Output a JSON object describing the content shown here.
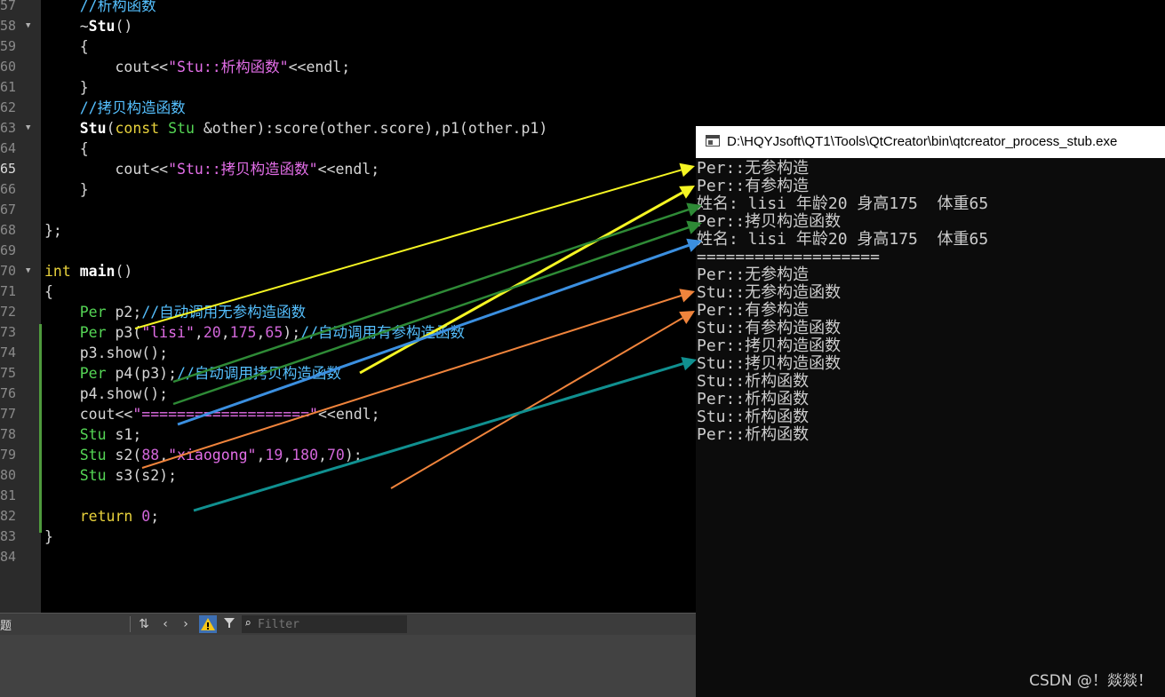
{
  "editor": {
    "gutter": [
      {
        "num": "57",
        "fold": ""
      },
      {
        "num": "58",
        "fold": "▼"
      },
      {
        "num": "59",
        "fold": ""
      },
      {
        "num": "60",
        "fold": ""
      },
      {
        "num": "61",
        "fold": ""
      },
      {
        "num": "62",
        "fold": ""
      },
      {
        "num": "63",
        "fold": "▼"
      },
      {
        "num": "64",
        "fold": ""
      },
      {
        "num": "65",
        "fold": ""
      },
      {
        "num": "66",
        "fold": ""
      },
      {
        "num": "67",
        "fold": ""
      },
      {
        "num": "68",
        "fold": ""
      },
      {
        "num": "69",
        "fold": ""
      },
      {
        "num": "70",
        "fold": "▼"
      },
      {
        "num": "71",
        "fold": ""
      },
      {
        "num": "72",
        "fold": ""
      },
      {
        "num": "73",
        "fold": ""
      },
      {
        "num": "74",
        "fold": ""
      },
      {
        "num": "75",
        "fold": ""
      },
      {
        "num": "76",
        "fold": ""
      },
      {
        "num": "77",
        "fold": ""
      },
      {
        "num": "78",
        "fold": ""
      },
      {
        "num": "79",
        "fold": ""
      },
      {
        "num": "80",
        "fold": ""
      },
      {
        "num": "81",
        "fold": ""
      },
      {
        "num": "82",
        "fold": ""
      },
      {
        "num": "83",
        "fold": ""
      },
      {
        "num": "84",
        "fold": ""
      }
    ],
    "current_line": "65",
    "code_lines": [
      [
        {
          "t": "    ",
          "c": "pl"
        },
        {
          "t": "//析构函数",
          "c": "cm"
        }
      ],
      [
        {
          "t": "    ~",
          "c": "pl"
        },
        {
          "t": "Stu",
          "c": "fn"
        },
        {
          "t": "()",
          "c": "pl"
        }
      ],
      [
        {
          "t": "    {",
          "c": "pl"
        }
      ],
      [
        {
          "t": "        cout<<",
          "c": "pl"
        },
        {
          "t": "\"Stu::析构函数\"",
          "c": "st"
        },
        {
          "t": "<<endl;",
          "c": "pl"
        }
      ],
      [
        {
          "t": "    }",
          "c": "pl"
        }
      ],
      [
        {
          "t": "    ",
          "c": "pl"
        },
        {
          "t": "//拷贝构造函数",
          "c": "cm"
        }
      ],
      [
        {
          "t": "    ",
          "c": "pl"
        },
        {
          "t": "Stu",
          "c": "fn"
        },
        {
          "t": "(",
          "c": "pl"
        },
        {
          "t": "const",
          "c": "kw"
        },
        {
          "t": " ",
          "c": "pl"
        },
        {
          "t": "Stu",
          "c": "ty"
        },
        {
          "t": " &other):score(other.score),p1(other.p1)",
          "c": "pl"
        }
      ],
      [
        {
          "t": "    {",
          "c": "pl"
        }
      ],
      [
        {
          "t": "        cout<<",
          "c": "pl"
        },
        {
          "t": "\"Stu::拷贝构造函数\"",
          "c": "st"
        },
        {
          "t": "<<endl;",
          "c": "pl"
        }
      ],
      [
        {
          "t": "    }",
          "c": "pl"
        }
      ],
      [],
      [
        {
          "t": "};",
          "c": "pl"
        }
      ],
      [],
      [
        {
          "t": "int",
          "c": "kw"
        },
        {
          "t": " ",
          "c": "pl"
        },
        {
          "t": "main",
          "c": "fn"
        },
        {
          "t": "()",
          "c": "pl"
        }
      ],
      [
        {
          "t": "{",
          "c": "pl"
        }
      ],
      [
        {
          "t": "    ",
          "c": "pl"
        },
        {
          "t": "Per",
          "c": "ty"
        },
        {
          "t": " p2;",
          "c": "pl"
        },
        {
          "t": "//自动调用无参构造函数",
          "c": "cm"
        }
      ],
      [
        {
          "t": "    ",
          "c": "pl"
        },
        {
          "t": "Per",
          "c": "ty"
        },
        {
          "t": " p3(",
          "c": "pl"
        },
        {
          "t": "\"lisi\"",
          "c": "st"
        },
        {
          "t": ",",
          "c": "pl"
        },
        {
          "t": "20",
          "c": "nm"
        },
        {
          "t": ",",
          "c": "pl"
        },
        {
          "t": "175",
          "c": "nm"
        },
        {
          "t": ",",
          "c": "pl"
        },
        {
          "t": "65",
          "c": "nm"
        },
        {
          "t": ");",
          "c": "pl"
        },
        {
          "t": "//自动调用有参构造函数",
          "c": "cm"
        }
      ],
      [
        {
          "t": "    p3.show();",
          "c": "pl"
        }
      ],
      [
        {
          "t": "    ",
          "c": "pl"
        },
        {
          "t": "Per",
          "c": "ty"
        },
        {
          "t": " p4(p3);",
          "c": "pl"
        },
        {
          "t": "//自动调用拷贝构造函数",
          "c": "cm"
        }
      ],
      [
        {
          "t": "    p4.show();",
          "c": "pl"
        }
      ],
      [
        {
          "t": "    cout<<",
          "c": "pl"
        },
        {
          "t": "\"===================\"",
          "c": "st"
        },
        {
          "t": "<<endl;",
          "c": "pl"
        }
      ],
      [
        {
          "t": "    ",
          "c": "pl"
        },
        {
          "t": "Stu",
          "c": "ty"
        },
        {
          "t": " s1;",
          "c": "pl"
        }
      ],
      [
        {
          "t": "    ",
          "c": "pl"
        },
        {
          "t": "Stu",
          "c": "ty"
        },
        {
          "t": " s2(",
          "c": "pl"
        },
        {
          "t": "88",
          "c": "nm"
        },
        {
          "t": ",",
          "c": "pl"
        },
        {
          "t": "\"xiaogong\"",
          "c": "st"
        },
        {
          "t": ",",
          "c": "pl"
        },
        {
          "t": "19",
          "c": "nm"
        },
        {
          "t": ",",
          "c": "pl"
        },
        {
          "t": "180",
          "c": "nm"
        },
        {
          "t": ",",
          "c": "pl"
        },
        {
          "t": "70",
          "c": "nm"
        },
        {
          "t": ");",
          "c": "pl"
        }
      ],
      [
        {
          "t": "    ",
          "c": "pl"
        },
        {
          "t": "Stu",
          "c": "ty"
        },
        {
          "t": " s3(s2);",
          "c": "pl"
        }
      ],
      [],
      [
        {
          "t": "    ",
          "c": "pl"
        },
        {
          "t": "return",
          "c": "kw"
        },
        {
          "t": " ",
          "c": "pl"
        },
        {
          "t": "0",
          "c": "nm"
        },
        {
          "t": ";",
          "c": "pl"
        }
      ],
      [
        {
          "t": "}",
          "c": "pl"
        }
      ],
      []
    ]
  },
  "statusbar": {
    "left_text": "题",
    "filter_placeholder": "Filter",
    "icons": [
      "sort-icon",
      "chevron-left-icon",
      "chevron-right-icon",
      "warning-icon",
      "filter-icon",
      "search-icon"
    ]
  },
  "console": {
    "title": "D:\\HQYJsoft\\QT1\\Tools\\QtCreator\\bin\\qtcreator_process_stub.exe",
    "output": [
      "Per::无参构造",
      "Per::有参构造",
      "姓名: lisi 年龄20 身高175  体重65",
      "Per::拷贝构造函数",
      "姓名: lisi 年龄20 身高175  体重65",
      "===================",
      "Per::无参构造",
      "Stu::无参构造函数",
      "Per::有参构造",
      "Stu::有参构造函数",
      "Per::拷贝构造函数",
      "Stu::拷贝构造函数",
      "Stu::析构函数",
      "Per::析构函数",
      "Stu::析构函数",
      "Per::析构函数"
    ]
  },
  "watermark": "CSDN @！燚燚！",
  "annotation_colors": {
    "yellow": "#f5f523",
    "green": "#2e8a36",
    "blue": "#3b8fe0",
    "orange": "#f0843c",
    "teal": "#109090"
  }
}
